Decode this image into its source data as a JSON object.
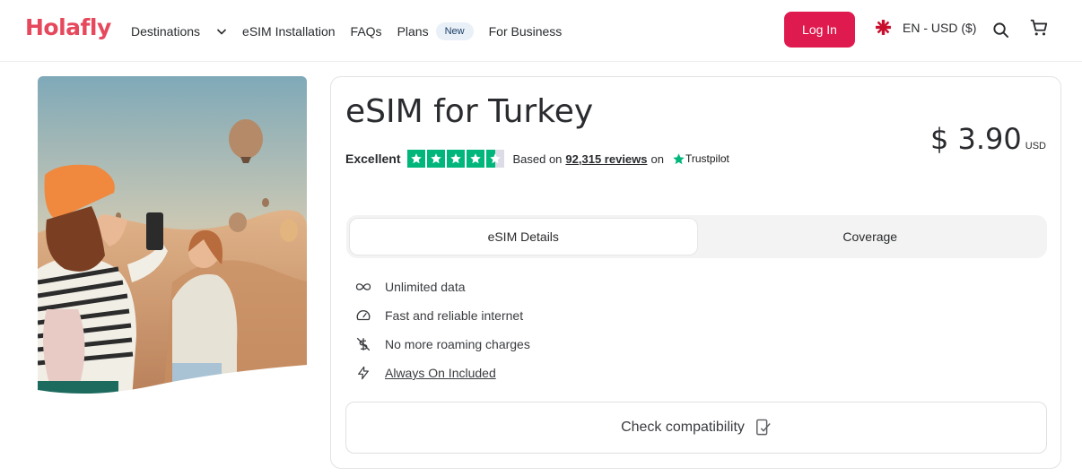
{
  "header": {
    "logo": "Holafly",
    "nav": [
      {
        "label": "Destinations"
      },
      {
        "label": "eSIM Installation"
      },
      {
        "label": "FAQs"
      },
      {
        "label": "Plans",
        "badge": "New"
      },
      {
        "label": "For Business"
      }
    ],
    "login_label": "Log In",
    "language": "EN - USD ($)",
    "icons": [
      "uk-flag-icon",
      "search-icon",
      "cart-icon"
    ]
  },
  "product": {
    "title": "eSIM for Turkey",
    "rating_word": "Excellent",
    "stars": 4.5,
    "based_on": "Based on",
    "reviews_count": "92,315 reviews",
    "on": "on",
    "trustpilot": "Trustpilot",
    "price": "$ 3.90",
    "currency": "USD",
    "tabs": [
      {
        "label": "eSIM Details",
        "active": true
      },
      {
        "label": "Coverage",
        "active": false
      }
    ],
    "features": [
      {
        "icon": "infinity-icon",
        "label": "Unlimited data"
      },
      {
        "icon": "speedometer-icon",
        "label": "Fast and reliable internet"
      },
      {
        "icon": "no-roaming-icon",
        "label": "No more roaming charges"
      },
      {
        "icon": "lightning-icon",
        "label": "Always On Included"
      }
    ],
    "compat_label": "Check compatibility"
  },
  "colors": {
    "brand": "#e6485c",
    "login": "#df1a4e",
    "trustpilot_green": "#00b67a"
  }
}
